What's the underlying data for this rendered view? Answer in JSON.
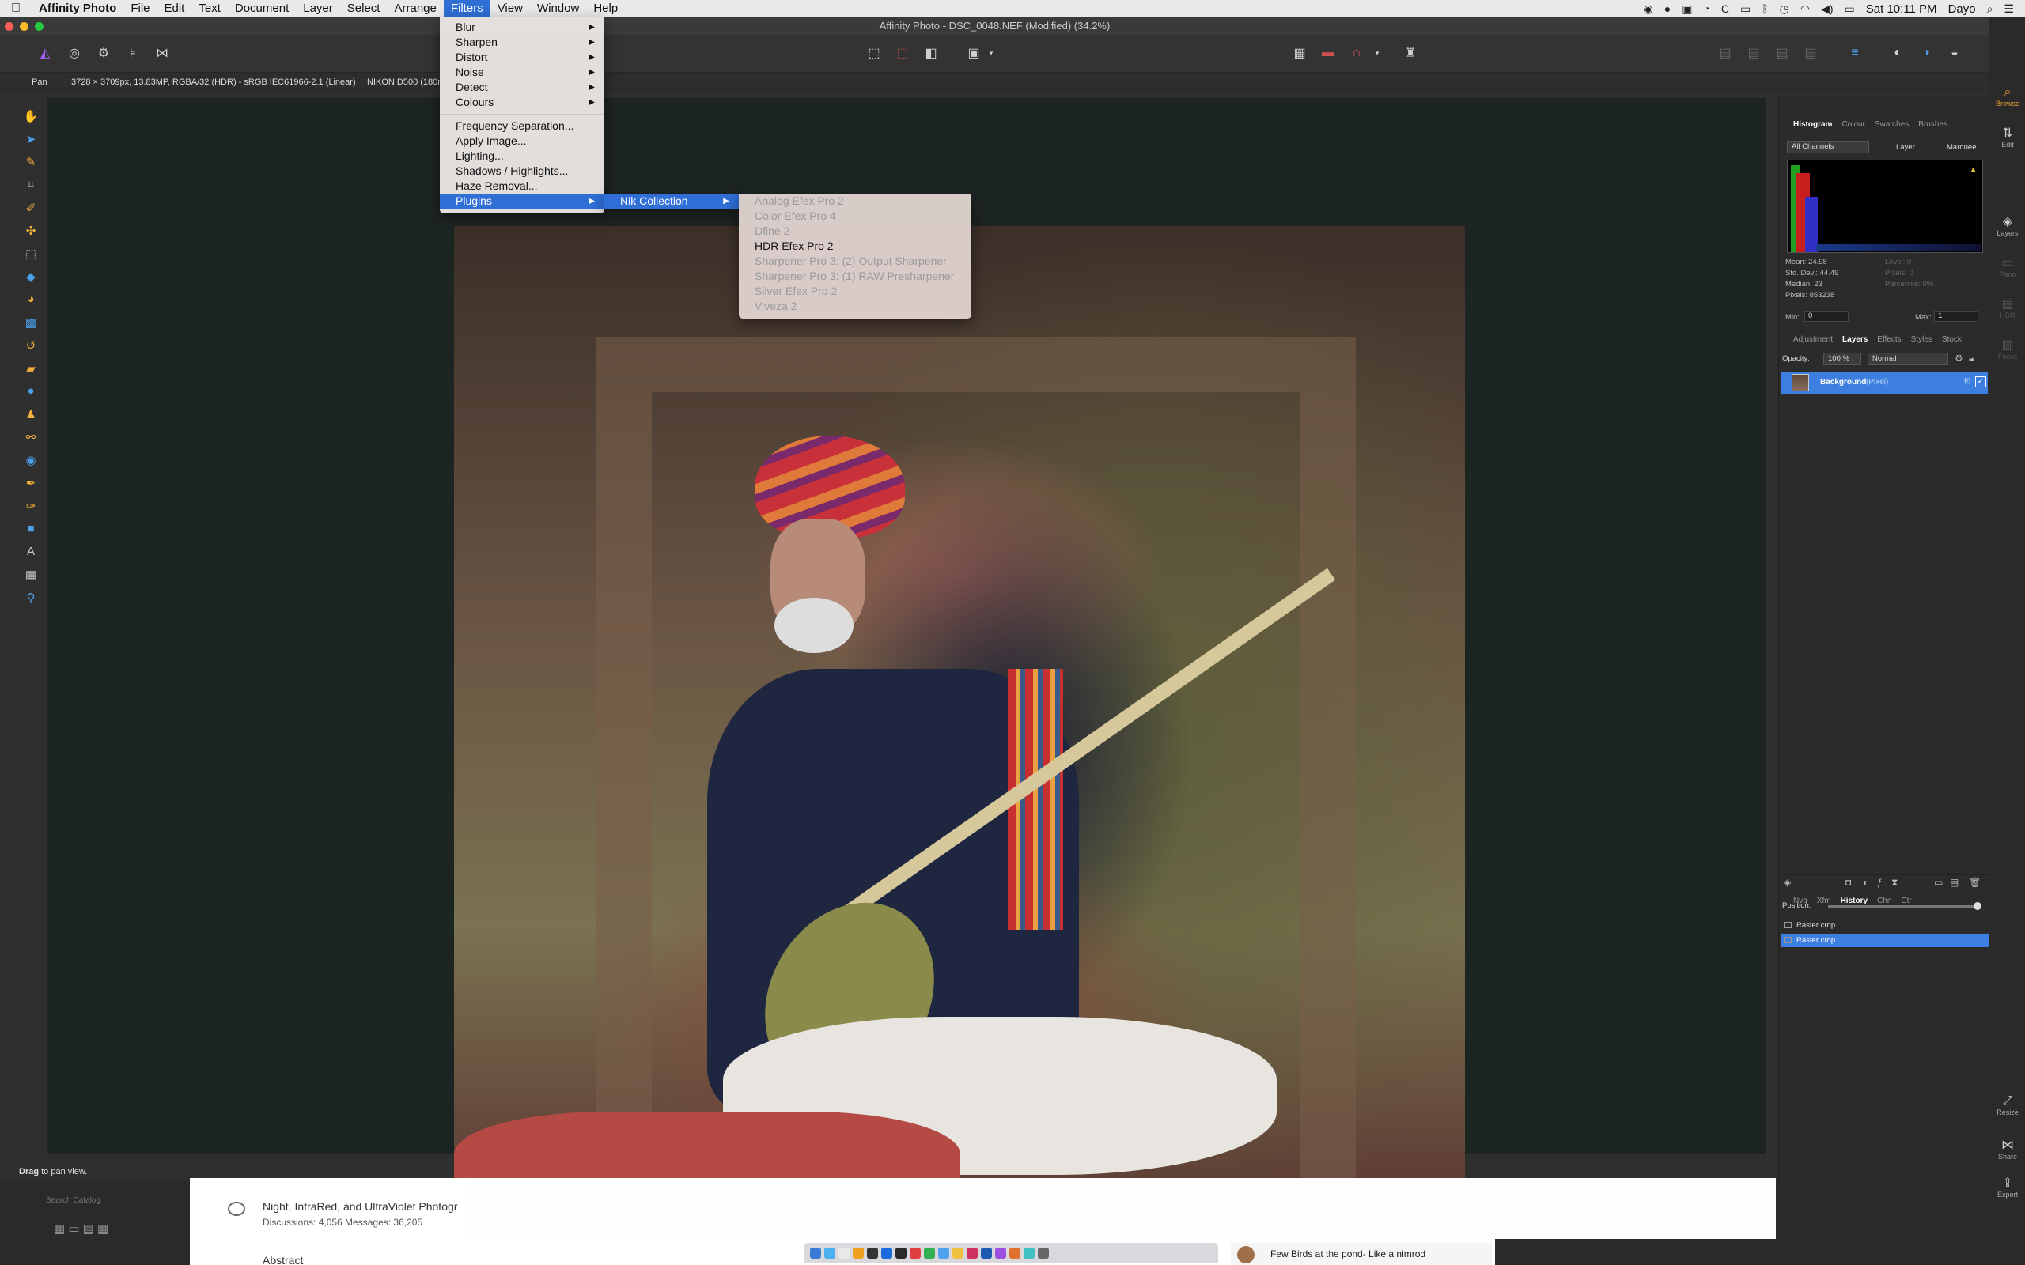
{
  "menubar": {
    "apple": "",
    "app_name": "Affinity Photo",
    "items": [
      "File",
      "Edit",
      "Text",
      "Document",
      "Layer",
      "Select",
      "Arrange",
      "Filters",
      "View",
      "Window",
      "Help"
    ],
    "active": "Filters",
    "clock": "Sat 10:11 PM",
    "user": "Dayo"
  },
  "window": {
    "title": "Affinity Photo - DSC_0048.NEF (Modified) (34.2%)"
  },
  "context": {
    "tool": "Pan",
    "info": "3728 × 3709px, 13.83MP, RGBA/32 (HDR) - sRGB IEC61966-2.1 (Linear)",
    "camera": "NIKON D500 (180m"
  },
  "status": {
    "bold": "Drag",
    "rest": " to pan view."
  },
  "filters_menu": {
    "items": [
      "Blur",
      "Sharpen",
      "Distort",
      "Noise",
      "Detect",
      "Colours"
    ],
    "items2": [
      "Frequency Separation...",
      "Apply Image...",
      "Lighting...",
      "Shadows / Highlights...",
      "Haze Removal..."
    ],
    "plugins": "Plugins"
  },
  "plugins_menu": {
    "nik": "Nik Collection"
  },
  "nik_menu": {
    "items": [
      {
        "label": "Analog Efex Pro 2",
        "enabled": false
      },
      {
        "label": "Color Efex Pro 4",
        "enabled": false
      },
      {
        "label": "Dfine 2",
        "enabled": false
      },
      {
        "label": "HDR Efex Pro 2",
        "enabled": true
      },
      {
        "label": "Sharpener Pro 3: (2) Output Sharpener",
        "enabled": false
      },
      {
        "label": "Sharpener Pro 3: (1) RAW Presharpener",
        "enabled": false
      },
      {
        "label": "Silver Efex Pro 2",
        "enabled": false
      },
      {
        "label": "Viveza 2",
        "enabled": false
      }
    ]
  },
  "panel": {
    "top_tabs": [
      "Histogram",
      "Colour",
      "Swatches",
      "Brushes"
    ],
    "channels": "All Channels",
    "layer_label": "Layer",
    "marquee_label": "Marquee",
    "stats": {
      "mean": "Mean: 24.98",
      "std": "Std. Dev.: 44.49",
      "median": "Median: 23",
      "pixels": "Pixels: 853238",
      "level": "Level: 0",
      "pixels2": "Pixels: 0",
      "percentile": "Percentile: 0%"
    },
    "min_label": "Min:",
    "min_value": "0",
    "max_label": "Max:",
    "max_value": "1",
    "mid_tabs": [
      "Adjustment",
      "Layers",
      "Effects",
      "Styles",
      "Stock"
    ],
    "opacity_label": "Opacity:",
    "opacity_value": "100 %",
    "blend_mode": "Normal",
    "layer_name": "Background",
    "layer_type": "(Pixel)",
    "bottom_tabs": [
      "Nvg",
      "Xfm",
      "History",
      "Chn",
      "Ctr"
    ],
    "position_label": "Position:",
    "history": [
      "Raster crop",
      "Raster crop"
    ]
  },
  "persona": {
    "items": [
      "Browse",
      "Edit",
      "Layers",
      "Pano",
      "HDR",
      "Focus"
    ],
    "bottom": [
      "Resize",
      "Share",
      "Export"
    ]
  },
  "background_window": {
    "forum_title": "Night, InfraRed, and UltraViolet Photogr",
    "forum_stats": "Discussions: 4,056   Messages: 36,205",
    "forum_title2": "Abstract",
    "search": "Search Catalog"
  },
  "notification": "Few Birds at the pond- Like a nimrod",
  "colors": {
    "accent": "#2f6fd6",
    "selection": "#3d7fe0",
    "tool_orange": "#f0b03a",
    "canvas_bg": "#1d2523"
  }
}
